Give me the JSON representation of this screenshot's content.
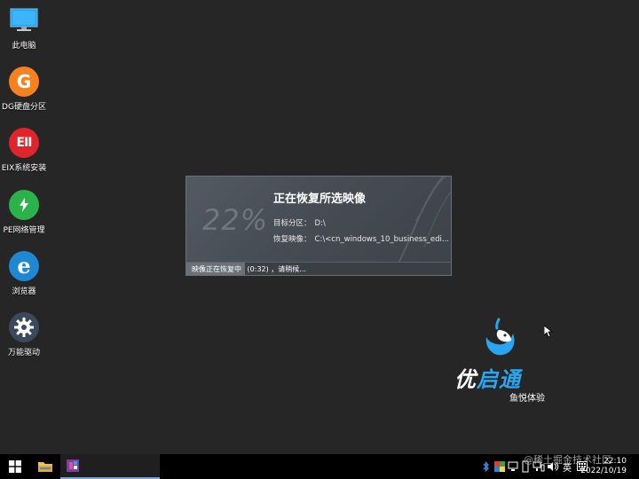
{
  "desktop": {
    "icons": [
      {
        "label": "此电脑",
        "icon": "computer-icon"
      },
      {
        "label": "DG硬盘分区",
        "icon": "dg-icon",
        "glyph": "G",
        "color": "#f5821f"
      },
      {
        "label": "EIX系统安装",
        "icon": "eix-icon",
        "glyph": "EII",
        "color": "#e0242b"
      },
      {
        "label": "PE网络管理",
        "icon": "network-icon",
        "color": "#2bb34a"
      },
      {
        "label": "浏览器",
        "icon": "browser-icon",
        "glyph": "e",
        "color": "#1e88d2"
      },
      {
        "label": "万能驱动",
        "icon": "gear-icon",
        "color": "#3a4a5c"
      }
    ]
  },
  "dialog": {
    "title": "正在恢复所选映像",
    "percent": "22%",
    "progress": 0.22,
    "target_label": "目标分区：",
    "target_value": "D:\\",
    "image_label": "恢复映像：",
    "image_value": "C:\\<cn_windows_10_business_edi...",
    "status_prefix": "映像正在恢复中",
    "status_time": "(0:32) ，请稍候..."
  },
  "brand": {
    "name_part1": "优",
    "name_part2": "启通",
    "subtitle": "鱼悦体验",
    "accent": "#2aa6f0"
  },
  "taskbar": {
    "time": "22:10",
    "date": "2022/10/19",
    "ime": "英",
    "watermark": "@稀土掘金技术社区"
  }
}
